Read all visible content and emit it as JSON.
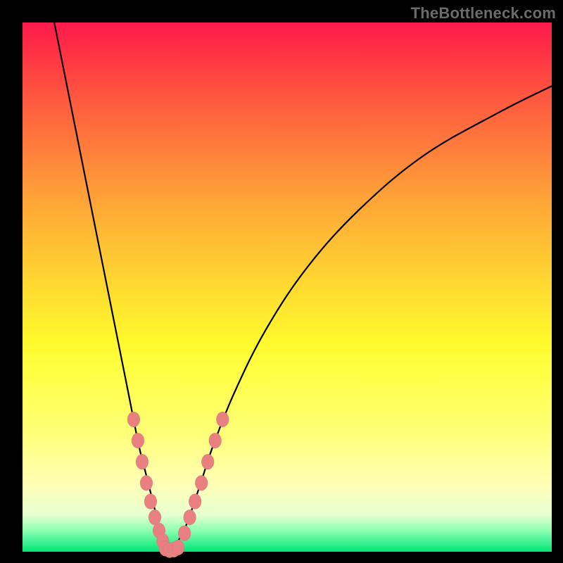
{
  "watermark": "TheBottleneck.com",
  "colors": {
    "frame_border": "#000000",
    "curve": "#000000",
    "marker": "#e98080",
    "gradient_top": "#ff1a4d",
    "gradient_bottom": "#00e676"
  },
  "chart_data": {
    "type": "line",
    "title": "",
    "xlabel": "",
    "ylabel": "",
    "xlim": [
      0,
      100
    ],
    "ylim": [
      0,
      100
    ],
    "grid": false,
    "legend": false,
    "series": [
      {
        "name": "left-branch",
        "x": [
          6,
          8,
          10,
          12,
          14,
          16,
          18,
          20,
          22,
          23.5,
          25,
          26,
          27,
          27.8
        ],
        "y": [
          100,
          90,
          80,
          70,
          60,
          50,
          40,
          30,
          20,
          14,
          8,
          4,
          1.5,
          0
        ]
      },
      {
        "name": "right-branch",
        "x": [
          27.8,
          29,
          30.5,
          32,
          34,
          36,
          40,
          46,
          54,
          64,
          76,
          90,
          100
        ],
        "y": [
          0,
          1.5,
          4,
          8,
          14,
          20,
          30,
          42,
          54,
          65,
          75,
          83,
          88
        ]
      }
    ],
    "markers_series": [
      {
        "name": "left-branch-markers",
        "points": [
          {
            "x": 21.0,
            "y": 25
          },
          {
            "x": 21.8,
            "y": 21
          },
          {
            "x": 22.6,
            "y": 17
          },
          {
            "x": 23.4,
            "y": 13
          },
          {
            "x": 24.2,
            "y": 9.5
          },
          {
            "x": 25.0,
            "y": 6.5
          },
          {
            "x": 25.8,
            "y": 4
          },
          {
            "x": 26.5,
            "y": 2
          }
        ]
      },
      {
        "name": "minimum-markers",
        "points": [
          {
            "x": 27.0,
            "y": 0.6
          },
          {
            "x": 27.8,
            "y": 0.3
          },
          {
            "x": 28.6,
            "y": 0.4
          },
          {
            "x": 29.4,
            "y": 0.8
          }
        ]
      },
      {
        "name": "right-branch-markers",
        "points": [
          {
            "x": 30.6,
            "y": 3.5
          },
          {
            "x": 31.6,
            "y": 6.5
          },
          {
            "x": 32.6,
            "y": 9.5
          },
          {
            "x": 33.8,
            "y": 13
          },
          {
            "x": 35.0,
            "y": 17
          },
          {
            "x": 36.4,
            "y": 21
          },
          {
            "x": 37.8,
            "y": 25
          }
        ]
      }
    ],
    "annotations": []
  }
}
